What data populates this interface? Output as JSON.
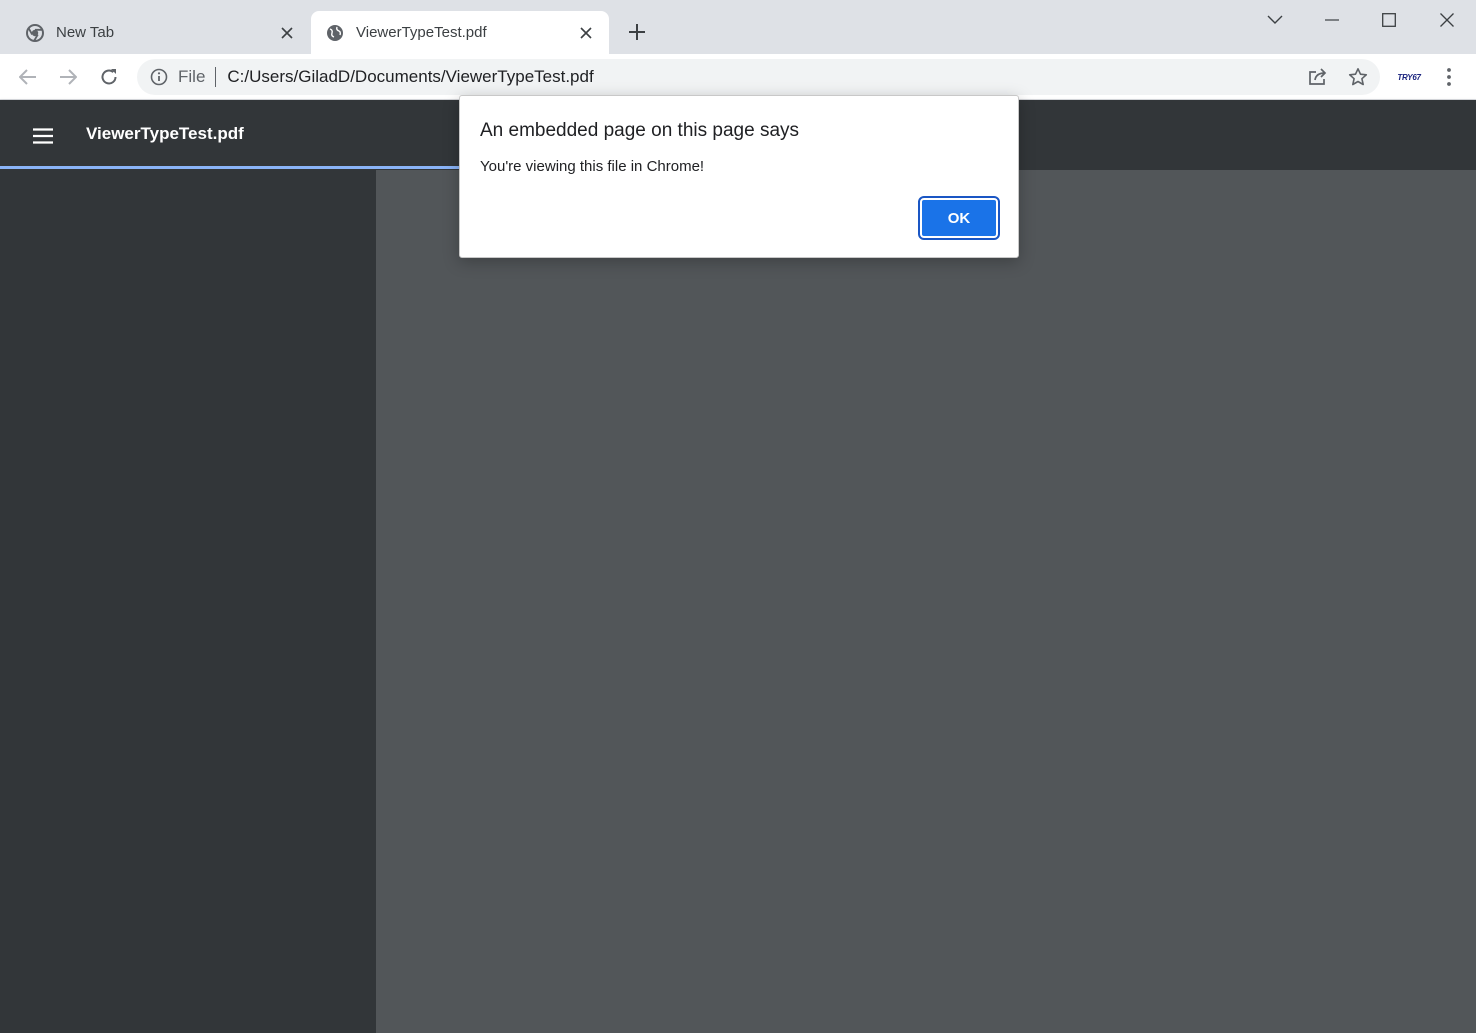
{
  "tabs": [
    {
      "title": "New Tab",
      "favicon": "chrome-icon"
    },
    {
      "title": "ViewerTypeTest.pdf",
      "favicon": "globe-icon"
    }
  ],
  "omnibox": {
    "scheme": "File",
    "url": "C:/Users/GiladD/Documents/ViewerTypeTest.pdf"
  },
  "extension": {
    "label": "TRY67"
  },
  "viewer": {
    "title": "ViewerTypeTest.pdf"
  },
  "dialog": {
    "title": "An embedded page on this page says",
    "message": "You're viewing this file in Chrome!",
    "ok_label": "OK"
  },
  "colors": {
    "tabstrip": "#dee1e6",
    "viewer_toolbar": "#323639",
    "viewer_background": "#525659",
    "accent": "#1a73e8"
  }
}
